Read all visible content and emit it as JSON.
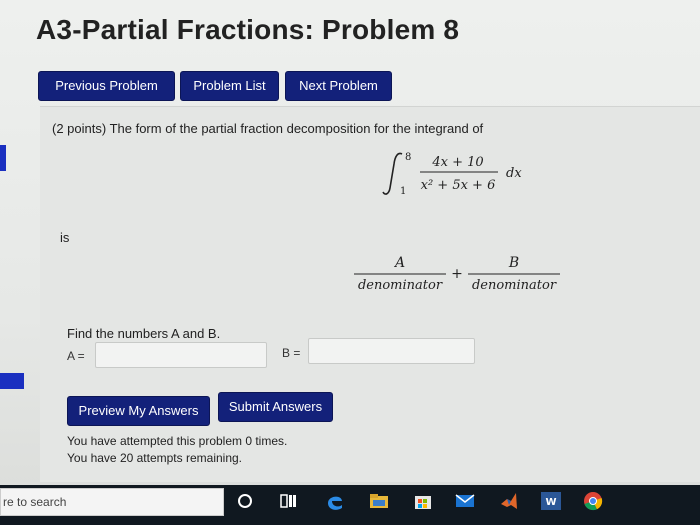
{
  "page": {
    "title": "A3-Partial Fractions: Problem 8"
  },
  "nav": {
    "previous": "Previous Problem",
    "list": "Problem List",
    "next": "Next Problem"
  },
  "problem": {
    "prompt": "(2 points) The form of the partial fraction decomposition for the integrand of",
    "integral": {
      "upper": "8",
      "lower": "1",
      "numerator": "4x + 10",
      "denominator": "x² + 5x + 6",
      "differential": "dx"
    },
    "is_word": "is",
    "decomposition": {
      "term1_num": "A",
      "term1_den": "denominator",
      "plus": "+",
      "term2_num": "B",
      "term2_den": "denominator"
    },
    "find_text": "Find the numbers A and B.",
    "a_label": "A =",
    "b_label": "B =",
    "a_value": "",
    "b_value": ""
  },
  "actions": {
    "preview": "Preview My Answers",
    "submit": "Submit Answers"
  },
  "attempts": {
    "line1": "You have attempted this problem 0 times.",
    "line2": "You have 20 attempts remaining."
  },
  "taskbar": {
    "search_text": "re to search",
    "icons": [
      "cortana-circle-icon",
      "task-view-icon",
      "edge-icon",
      "file-explorer-icon",
      "store-icon",
      "mail-icon",
      "matlab-icon",
      "word-icon",
      "chrome-icon"
    ]
  },
  "colors": {
    "button_bg": "#13217a",
    "accent_tab": "#1a2fc0",
    "taskbar": "#101820"
  }
}
